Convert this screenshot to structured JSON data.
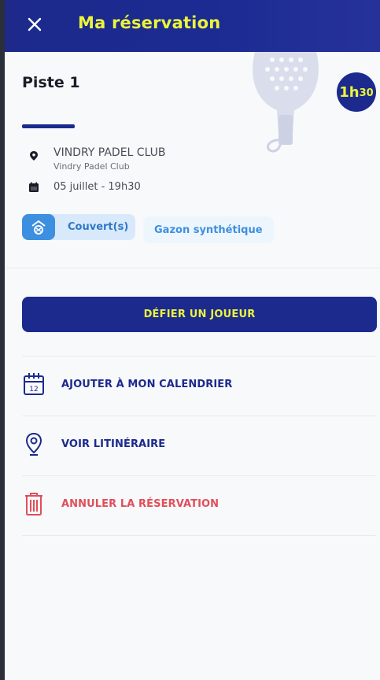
{
  "header": {
    "title": "Ma réservation",
    "close_icon": "close-icon"
  },
  "booking": {
    "court": "Piste 1",
    "duration_main": "1h",
    "duration_minutes": "30",
    "club_name": "VINDRY PADEL CLUB",
    "club_subtitle": "Vindry Padel Club",
    "date": "05 juillet - 19h30",
    "tags": {
      "covered": "Couvert(s)",
      "surface": "Gazon synthétique"
    }
  },
  "actions": {
    "challenge": "DÉFIER UN JOUEUR",
    "calendar": "AJOUTER À MON CALENDRIER",
    "calendar_day": "12",
    "directions": "VOIR LITINÉRAIRE",
    "cancel": "ANNULER LA RÉSERVATION"
  },
  "colors": {
    "primary": "#1c2a8e",
    "accent": "#ecf43a",
    "info": "#3d8fe0",
    "danger": "#e04f5a"
  }
}
